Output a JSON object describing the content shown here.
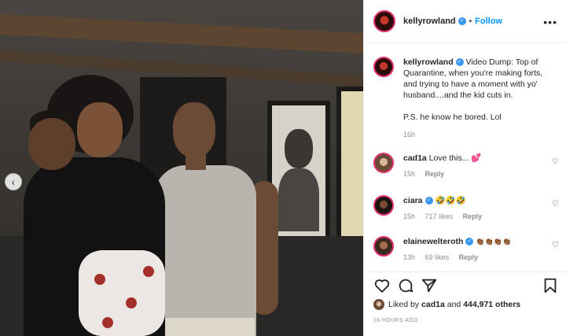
{
  "post": {
    "username": "kellyrowland",
    "follow_label": "Follow",
    "more_label": "•••",
    "carousel_icon": "chevron-left-icon"
  },
  "caption": {
    "username": "kellyrowland",
    "text": "Video Dump: Top of Quarantine, when you're making forts, and trying to have a moment with yo' husband....and the kid cuts in.",
    "text2": "P.S. he know he bored. Lol",
    "time": "16h"
  },
  "comments": [
    {
      "username": "cad1a",
      "text": "Love this...",
      "emoji": "💕",
      "time": "15h",
      "likes": "",
      "reply": "Reply"
    },
    {
      "username": "ciara",
      "text": "",
      "emoji": "🤣🤣🤣",
      "time": "15h",
      "likes": "717 likes",
      "reply": "Reply"
    },
    {
      "username": "elainewelteroth",
      "text": "",
      "emoji": "👏🏾👏🏾👏🏾👏🏾",
      "time": "13h",
      "likes": "69 likes",
      "reply": "Reply"
    }
  ],
  "likes": {
    "prefix": "Liked by",
    "user": "cad1a",
    "and": "and",
    "count": "444,971 others"
  },
  "posted_ago": "16 HOURS AGO",
  "colors": {
    "accent": "#0095f6",
    "verified": "#3897f0",
    "story_ring": "#e1306c"
  }
}
